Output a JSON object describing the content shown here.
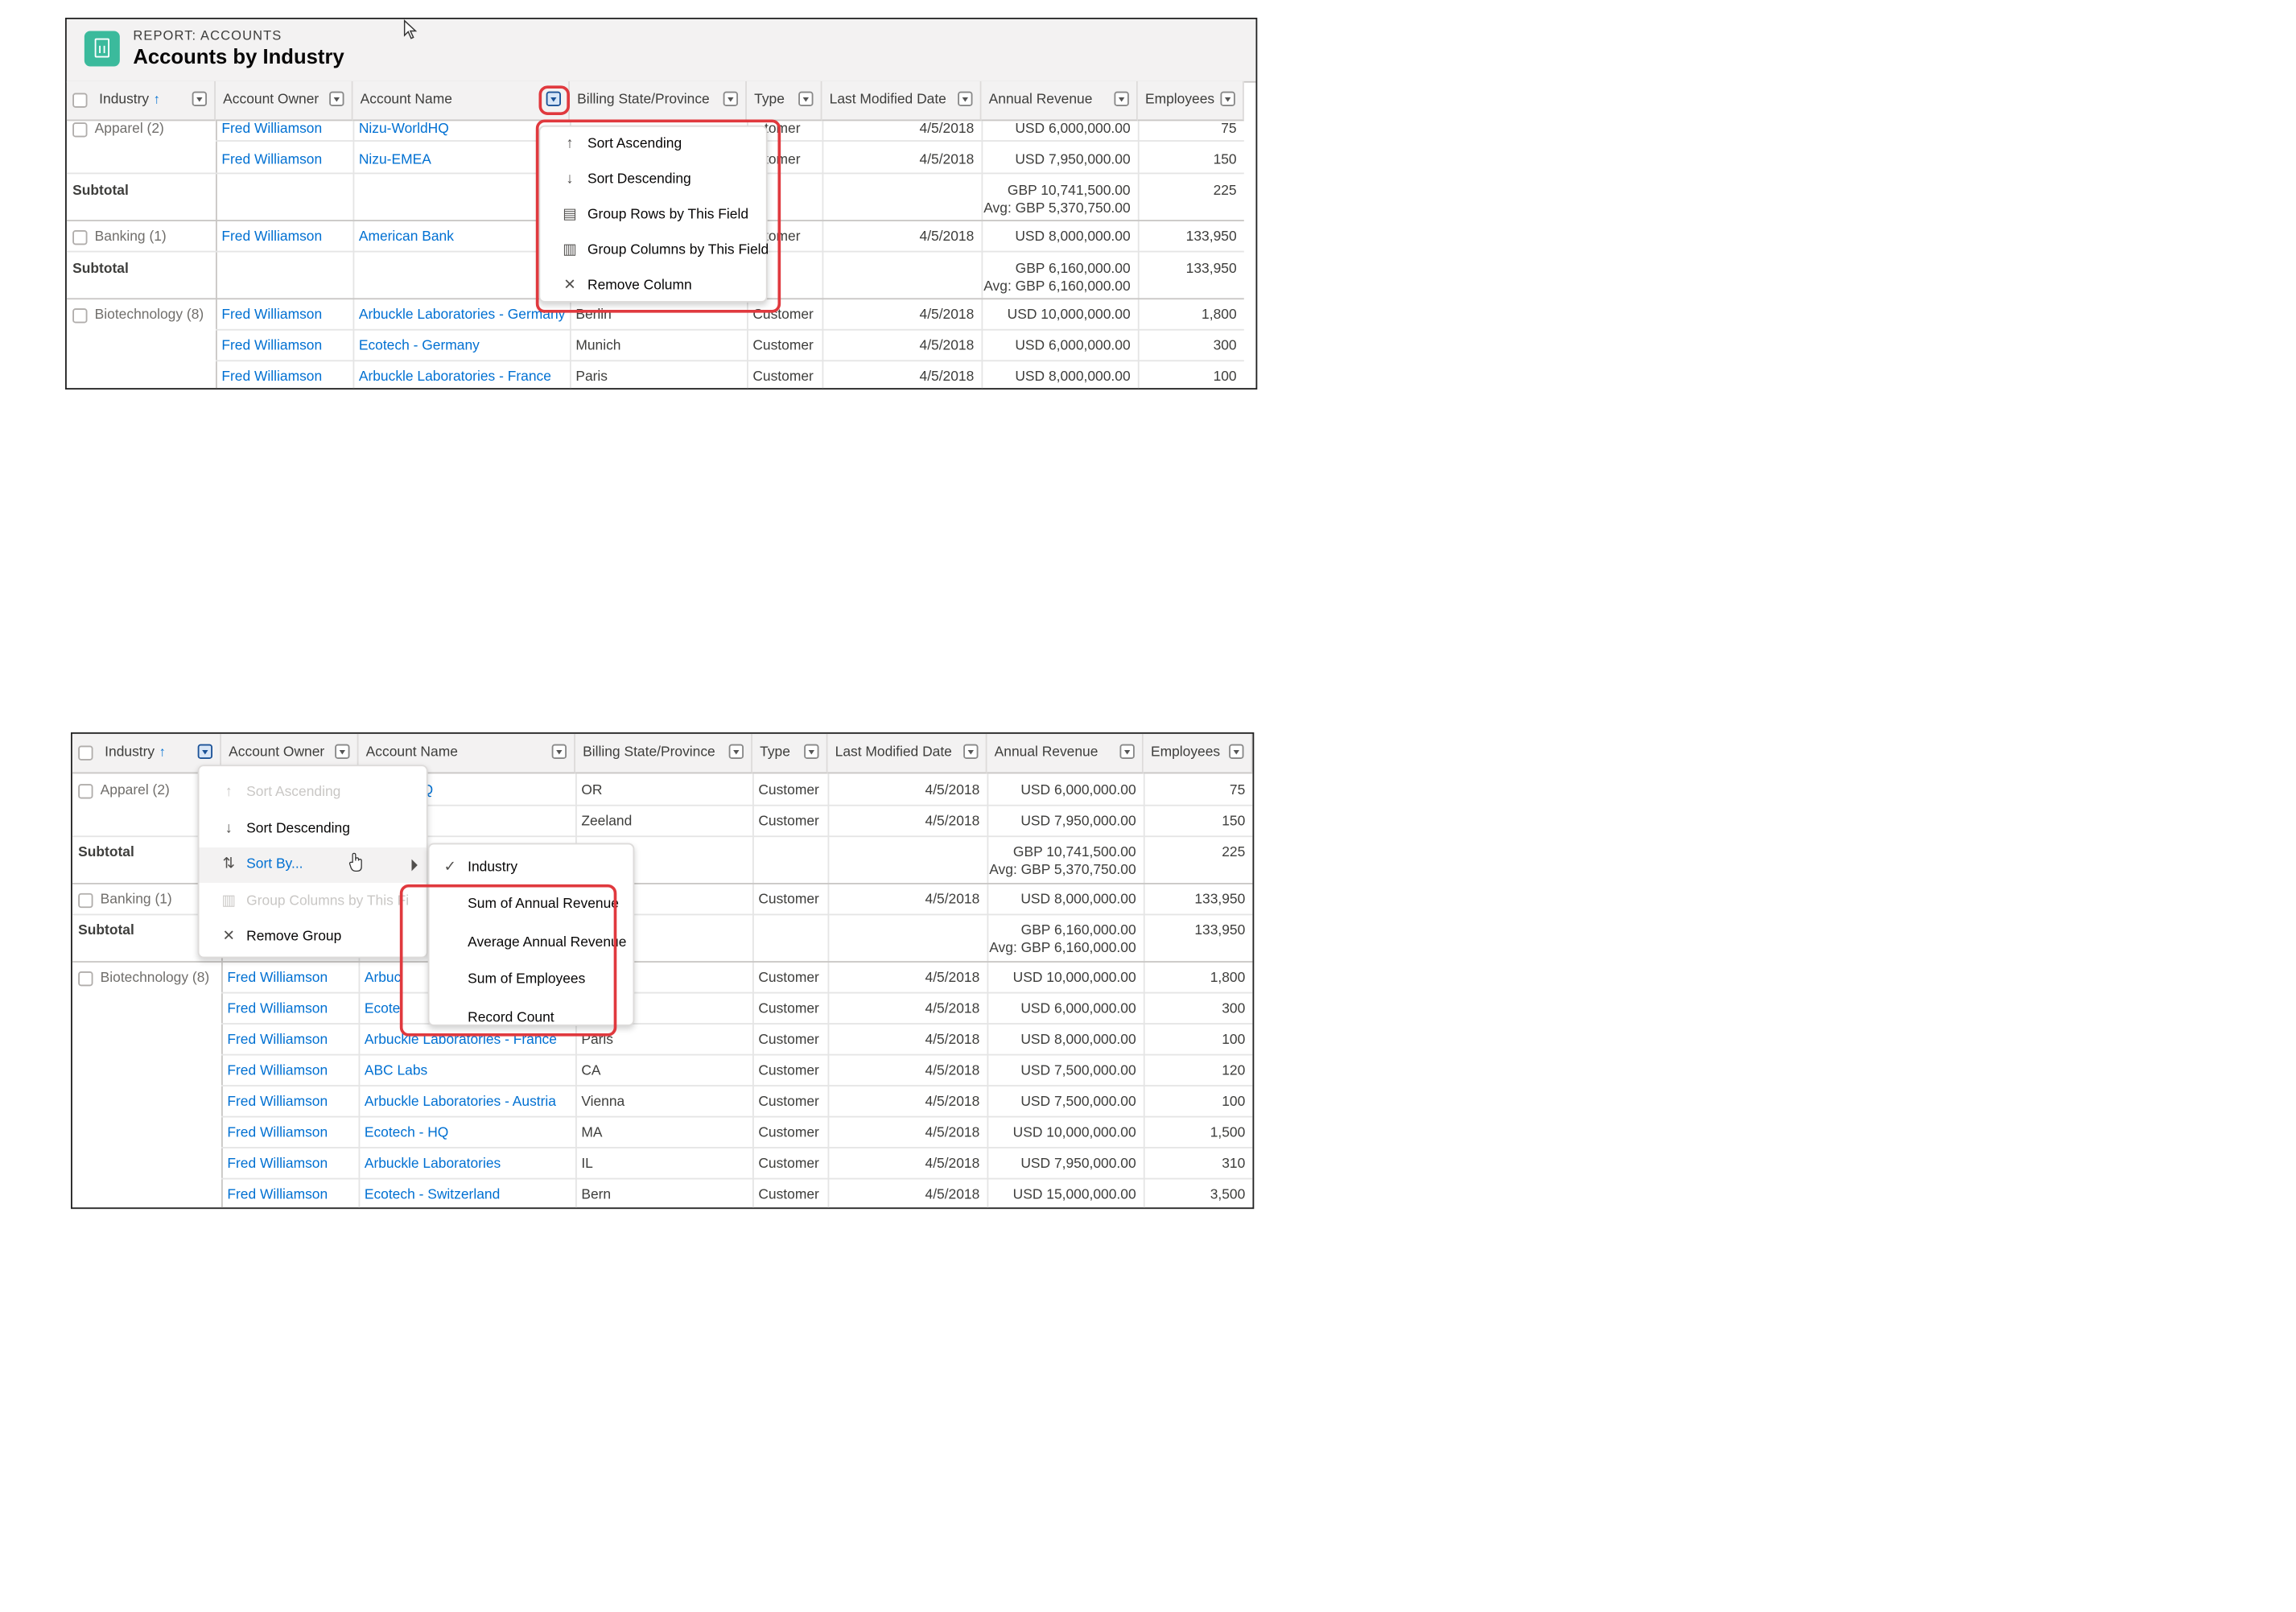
{
  "report": {
    "subtitle": "REPORT: ACCOUNTS",
    "title": "Accounts by Industry",
    "icon": "report-icon"
  },
  "columns": [
    "Industry",
    "Account Owner",
    "Account Name",
    "Billing State/Province",
    "Type",
    "Last Modified Date",
    "Annual Revenue",
    "Employees"
  ],
  "sort_indicator": "↑",
  "groups": {
    "apparel": "Apparel (2)",
    "banking": "Banking (1)",
    "biotech": "Biotechnology (8)"
  },
  "subtotal_label": "Subtotal",
  "subtotals": {
    "apparel": {
      "revenue": "GBP 10,741,500.00",
      "avg": "Avg: GBP 5,370,750.00",
      "employees": "225"
    },
    "banking": {
      "revenue": "GBP 6,160,000.00",
      "avg": "Avg: GBP 6,160,000.00",
      "employees": "133,950"
    }
  },
  "rows": [
    {
      "owner": "Fred Williamson",
      "name": "Nizu-WorldHQ",
      "state": "OR",
      "type": "Customer",
      "date": "4/5/2018",
      "revenue": "USD 6,000,000.00",
      "employees": "75"
    },
    {
      "owner": "Fred Williamson",
      "name": "Nizu-EMEA",
      "state": "Zeeland",
      "type": "Customer",
      "date": "4/5/2018",
      "revenue": "USD 7,950,000.00",
      "employees": "150"
    },
    {
      "owner": "Fred Williamson",
      "name": "American Bank",
      "state": "",
      "type": "Customer",
      "date": "4/5/2018",
      "revenue": "USD 8,000,000.00",
      "employees": "133,950"
    },
    {
      "owner": "Fred Williamson",
      "name": "Arbuckle Laboratories - Germany",
      "state": "Berlin",
      "type": "Customer",
      "date": "4/5/2018",
      "revenue": "USD 10,000,000.00",
      "employees": "1,800"
    },
    {
      "owner": "Fred Williamson",
      "name": "Ecotech - Germany",
      "state": "Munich",
      "type": "Customer",
      "date": "4/5/2018",
      "revenue": "USD 6,000,000.00",
      "employees": "300"
    },
    {
      "owner": "Fred Williamson",
      "name": "Arbuckle Laboratories - France",
      "state": "Paris",
      "type": "Customer",
      "date": "4/5/2018",
      "revenue": "USD 8,000,000.00",
      "employees": "100"
    },
    {
      "owner": "Fred Williamson",
      "name": "ABC Labs",
      "state": "CA",
      "type": "Customer",
      "date": "4/5/2018",
      "revenue": "USD 7,500,000.00",
      "employees": "120"
    },
    {
      "owner": "Fred Williamson",
      "name": "Arbuckle Laboratories - Austria",
      "state": "Vienna",
      "type": "Customer",
      "date": "4/5/2018",
      "revenue": "USD 7,500,000.00",
      "employees": "100"
    },
    {
      "owner": "Fred Williamson",
      "name": "Ecotech - HQ",
      "state": "MA",
      "type": "Customer",
      "date": "4/5/2018",
      "revenue": "USD 10,000,000.00",
      "employees": "1,500"
    },
    {
      "owner": "Fred Williamson",
      "name": "Arbuckle Laboratories",
      "state": "IL",
      "type": "Customer",
      "date": "4/5/2018",
      "revenue": "USD 7,950,000.00",
      "employees": "310"
    },
    {
      "owner": "Fred Williamson",
      "name": "Ecotech - Switzerland",
      "state": "Bern",
      "type": "Customer",
      "date": "4/5/2018",
      "revenue": "USD 15,000,000.00",
      "employees": "3,500"
    }
  ],
  "top_type_partial": "tomer",
  "column_menu": {
    "items": [
      {
        "label": "Sort Ascending",
        "icon": "arrow-up-icon"
      },
      {
        "label": "Sort Descending",
        "icon": "arrow-down-icon"
      },
      {
        "label": "Group Rows by This Field",
        "icon": "group-rows-icon"
      },
      {
        "label": "Group Columns by This Field",
        "icon": "group-columns-icon"
      },
      {
        "label": "Remove Column",
        "icon": "close-icon"
      }
    ]
  },
  "group_menu": {
    "items": [
      {
        "label": "Sort Ascending",
        "icon": "arrow-up-icon",
        "disabled": true
      },
      {
        "label": "Sort Descending",
        "icon": "arrow-down-icon",
        "disabled": false
      },
      {
        "label": "Sort By...",
        "icon": "sort-icon",
        "disabled": false
      },
      {
        "label": "Group Columns by This Fi",
        "icon": "group-columns-icon",
        "disabled": true
      },
      {
        "label": "Remove Group",
        "icon": "close-icon",
        "disabled": false
      }
    ]
  },
  "sort_by_menu": {
    "checked": "Industry",
    "items": [
      "Industry",
      "Sum of Annual Revenue",
      "Average Annual Revenue",
      "Sum of Employees",
      "Record Count"
    ]
  },
  "partial_names": {
    "dhq": "dHQ",
    "a": "A",
    "arbuc": "Arbuc",
    "ecote": "Ecote",
    "arbuckle_fr": "Arbuckle Laboratories - France",
    "n": "n",
    "ich": "ich",
    "paris": "Paris"
  },
  "colors": {
    "link": "#0070d2",
    "highlight": "#e0393e",
    "report_icon": "#3bba9c",
    "header_bg": "#f3f2f2"
  }
}
